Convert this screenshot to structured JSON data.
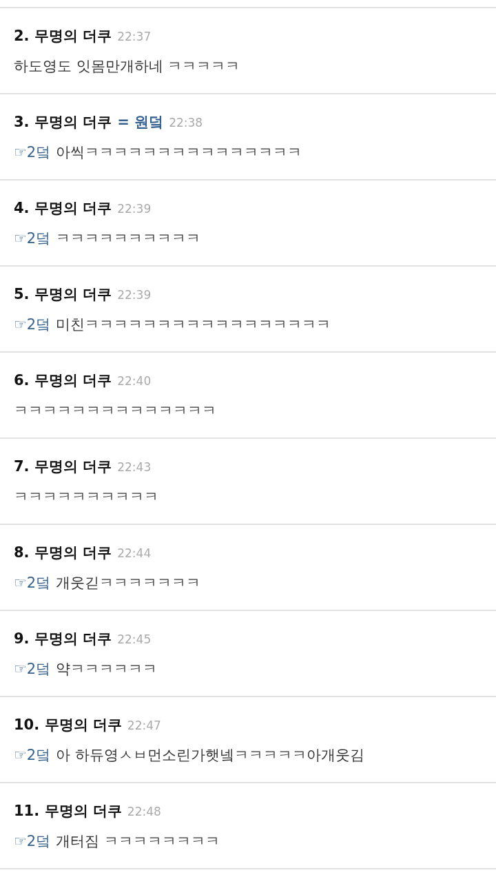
{
  "comments": [
    {
      "author": "2. 무명의 더쿠",
      "time": "22:37",
      "text": "하도영도 잇몸만개하네 ㅋㅋㅋㅋㅋ"
    },
    {
      "author": "3. 무명의 더쿠",
      "tag": "= 원덬",
      "time": "22:38",
      "reply": "☞2덬",
      "text": "아씩ㅋㅋㅋㅋㅋㅋㅋㅋㅋㅋㅋㅋㅋㅋㅋ"
    },
    {
      "author": "4. 무명의 더쿠",
      "time": "22:39",
      "reply": "☞2덬",
      "text": "ㅋㅋㅋㅋㅋㅋㅋㅋㅋㅋ"
    },
    {
      "author": "5. 무명의 더쿠",
      "time": "22:39",
      "reply": "☞2덬",
      "text": "미친ㅋㅋㅋㅋㅋㅋㅋㅋㅋㅋㅋㅋㅋㅋㅋㅋㅋ"
    },
    {
      "author": "6. 무명의 더쿠",
      "time": "22:40",
      "text": "ㅋㅋㅋㅋㅋㅋㅋㅋㅋㅋㅋㅋㅋㅋ"
    },
    {
      "author": "7. 무명의 더쿠",
      "time": "22:43",
      "text": "ㅋㅋㅋㅋㅋㅋㅋㅋㅋㅋ"
    },
    {
      "author": "8. 무명의 더쿠",
      "time": "22:44",
      "reply": "☞2덬",
      "text": "개웃긷ㅋㅋㅋㅋㅋㅋㅋ"
    },
    {
      "author": "9. 무명의 더쿠",
      "time": "22:45",
      "reply": "☞2덬",
      "text": "약ㅋㅋㅋㅋㅋㅋ"
    },
    {
      "author": "10. 무명의 더쿠",
      "time": "22:47",
      "reply": "☞2덬",
      "text": "아 하듀영ㅅㅂ먼소린가햇넼ㅋㅋㅋㅋㅋ아개웃김"
    },
    {
      "author": "11. 무명의 더쿠",
      "time": "22:48",
      "reply": "☞2덬",
      "text": "개터짐 ㅋㅋㅋㅋㅋㅋㅋㅋ"
    }
  ]
}
